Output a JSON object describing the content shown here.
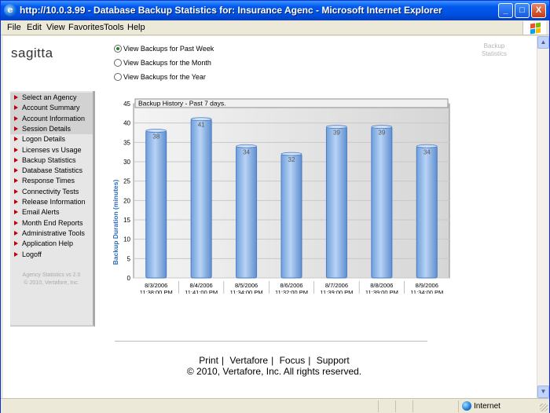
{
  "window": {
    "title": "http://10.0.3.99 - Database Backup Statistics for: Insurance Agenc - Microsoft Internet Explorer",
    "minimize_label": "_",
    "maximize_label": "□",
    "close_label": "X"
  },
  "menu": [
    "File",
    "Edit",
    "View",
    "Favorites",
    "Tools",
    "Help"
  ],
  "page": {
    "logo": "sagitta",
    "top_link": "Backup Statistics",
    "radios": [
      {
        "label": "View Backups for Past Week",
        "checked": true
      },
      {
        "label": "View Backups for the Month",
        "checked": false
      },
      {
        "label": "View Backups for the Year",
        "checked": false
      }
    ],
    "nav": [
      "Select an Agency",
      "Account Summary",
      "Account Information",
      "Session Details",
      "Logon Details",
      "Licenses vs Usage",
      "Backup Statistics",
      "Database Statistics",
      "Response Times",
      "Connectivity Tests",
      "Release Information",
      "Email Alerts",
      "Month End Reports",
      "Administrative Tools",
      "Application Help",
      "Logoff"
    ],
    "version_line1": "Agency Statistics vs 2.0",
    "version_line2": "© 2010,  Vertafore, Inc.",
    "footer_links": [
      "Print",
      "Vertafore",
      "Focus",
      "Support"
    ],
    "footer_separator": "|",
    "copyright": "© 2010,  Vertafore, Inc. All rights reserved."
  },
  "status": {
    "zone": "Internet"
  },
  "colors": {
    "nav_arrow": "#c00000",
    "bar_fill": "#8fb6e8",
    "bar_stroke": "#4a7cc4",
    "axis_title": "#2e6bb8"
  },
  "chart_data": {
    "type": "bar",
    "title": "Backup History - Past 7 days.",
    "ylabel": "Backup Duration (minutes)",
    "ylim": [
      0,
      45
    ],
    "yticks": [
      0,
      5,
      10,
      15,
      20,
      25,
      30,
      35,
      40,
      45
    ],
    "categories": [
      [
        "8/3/2006",
        "11:38:00 PM"
      ],
      [
        "8/4/2006",
        "11:41:00 PM"
      ],
      [
        "8/5/2006",
        "11:34:00 PM"
      ],
      [
        "8/6/2006",
        "11:32:00 PM"
      ],
      [
        "8/7/2006",
        "11:39:00 PM"
      ],
      [
        "8/8/2006",
        "11:39:00 PM"
      ],
      [
        "8/9/2006",
        "11:34:00 PM"
      ]
    ],
    "values": [
      38,
      41,
      34,
      32,
      39,
      39,
      34
    ],
    "grid": true
  }
}
